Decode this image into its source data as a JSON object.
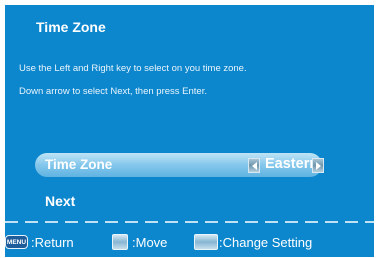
{
  "screen": {
    "title": "Time Zone",
    "instructions": [
      "Use the Left and Right key to select on you time zone.",
      "Down arrow to select Next, then press Enter."
    ]
  },
  "setting": {
    "label": "Time Zone",
    "value": "Eastern"
  },
  "next_label": "Next",
  "footer": {
    "menu_key": "MENU",
    "return_label": ":Return",
    "move_label": ":Move",
    "change_label": ":Change Setting"
  },
  "colors": {
    "background": "#0c86cd",
    "highlight": "#86c8ec",
    "text": "#ffffff"
  },
  "icons": [
    "left-arrow-icon",
    "right-arrow-icon",
    "navigate-buttons-icon",
    "left-right-buttons-icon"
  ]
}
